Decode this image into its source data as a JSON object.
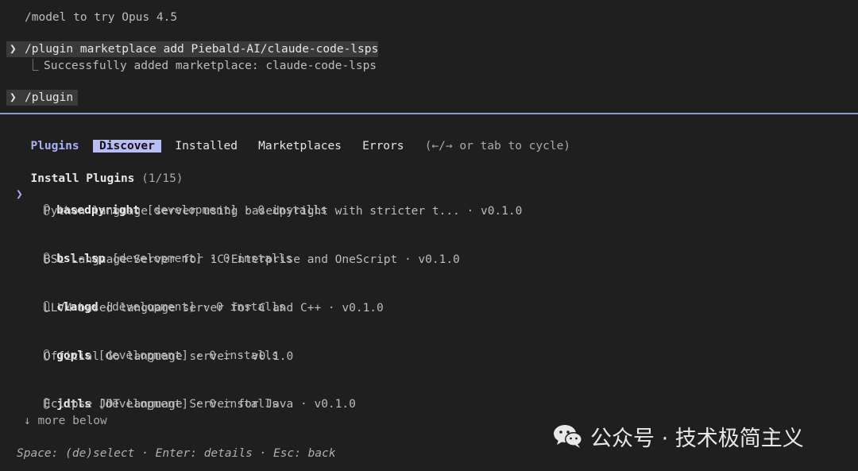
{
  "terminal": {
    "line_model_hint": "/model to try Opus 4.5",
    "cmd1_prompt": "❯",
    "cmd1_text": "/plugin marketplace add Piebald-AI/claude-code-lsps",
    "cmd1_result_prefix": "⎿",
    "cmd1_result": "Successfully added marketplace: claude-code-lsps",
    "cmd2_prompt": "❯",
    "cmd2_text": "/plugin"
  },
  "tabs": {
    "title": "Plugins",
    "items": [
      "Discover",
      "Installed",
      "Marketplaces",
      "Errors"
    ],
    "active": "Discover",
    "hint": "(←/→ or tab to cycle)"
  },
  "list": {
    "heading": "Install Plugins",
    "position": "(1/15)",
    "cursor": "❯",
    "plugins": [
      {
        "name": "basedpyright",
        "tag": "[development]",
        "installs": "· 0 installs",
        "description": "Python language server using basedpyright with stricter t... · v0.1.0"
      },
      {
        "name": "bsl-lsp",
        "tag": "[development]",
        "installs": "· 0 installs",
        "description": "BSL Language Server for 1C:Enterprise and OneScript · v0.1.0"
      },
      {
        "name": "clangd",
        "tag": "[development]",
        "installs": "· 0 installs",
        "description": "LLVM-based language server for C and C++ · v0.1.0"
      },
      {
        "name": "gopls",
        "tag": "[development]",
        "installs": "· 0 installs",
        "description": "Official Go language server · v0.1.0"
      },
      {
        "name": "jdtls",
        "tag": "[development]",
        "installs": "· 0 installs",
        "description": "Eclipse JDT Language Server for Java · v0.1.0"
      }
    ],
    "more": "↓ more below"
  },
  "footer": {
    "help": "Space: (de)select · Enter: details · Esc: back"
  },
  "watermark": {
    "icon": "wechat-icon",
    "text": "公众号 · 技术极简主义"
  },
  "colors": {
    "background": "#1f1f1f",
    "accent": "#aab0f5",
    "active_tab_bg": "#b9bdf5",
    "divider": "#8f96d6"
  }
}
